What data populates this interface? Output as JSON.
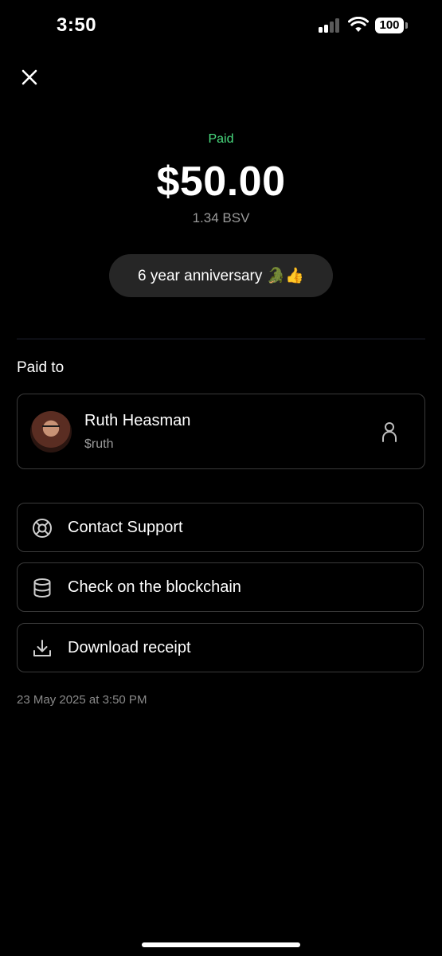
{
  "status_bar": {
    "time": "3:50",
    "battery": "100"
  },
  "payment": {
    "status": "Paid",
    "amount": "$50.00",
    "crypto_amount": "1.34 BSV",
    "note": "6 year anniversary 🐊👍",
    "status_color": "#4ade80"
  },
  "recipient": {
    "section_label": "Paid to",
    "name": "Ruth Heasman",
    "handle": "$ruth"
  },
  "actions": [
    {
      "label": "Contact Support",
      "icon": "lifebuoy-icon"
    },
    {
      "label": "Check on the blockchain",
      "icon": "database-icon"
    },
    {
      "label": "Download receipt",
      "icon": "download-icon"
    }
  ],
  "timestamp": "23 May 2025 at 3:50 PM"
}
